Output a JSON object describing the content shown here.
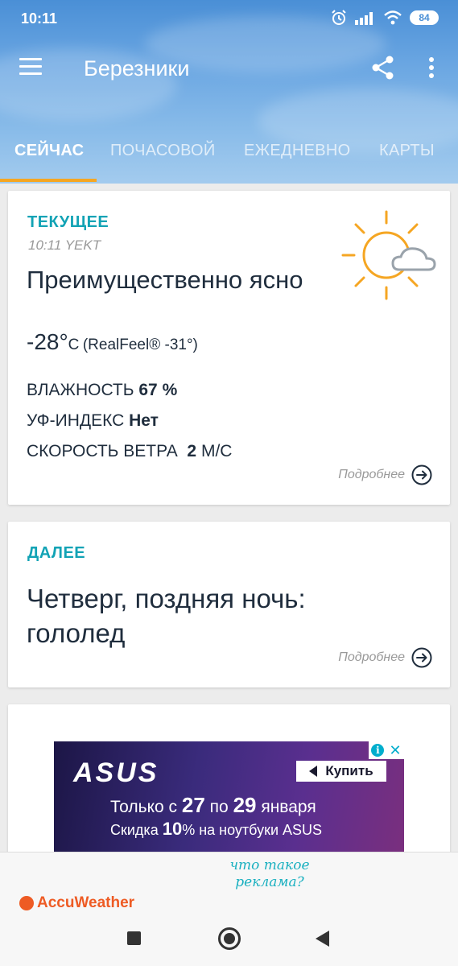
{
  "status_bar": {
    "time": "10:11",
    "battery": "84",
    "icons": [
      "alarm-icon",
      "signal-icon",
      "wifi-icon",
      "battery-icon"
    ]
  },
  "toolbar": {
    "city": "Березники",
    "icons": [
      "menu-icon",
      "share-icon",
      "more-vert-icon"
    ]
  },
  "tabs": [
    {
      "label": "СЕЙЧАС",
      "active": true
    },
    {
      "label": "ПОЧАСОВОЙ",
      "active": false
    },
    {
      "label": "ЕЖЕДНЕВНО",
      "active": false
    },
    {
      "label": "КАРТЫ",
      "active": false
    }
  ],
  "current": {
    "label": "ТЕКУЩЕЕ",
    "time": "10:11 YEKT",
    "condition": "Преимущественно ясно",
    "temperature": "-28°",
    "unit": "C",
    "realfeel": "(RealFeel® -31°)",
    "humidity_label": "ВЛАЖНОСТЬ",
    "humidity_value": "67 %",
    "uv_label": "УФ-ИНДЕКС",
    "uv_value": "Нет",
    "wind_label": "СКОРОСТЬ ВЕТРА",
    "wind_value": "2",
    "wind_unit": "М/С",
    "more": "Подробнее",
    "icon": "mostly-sunny-icon"
  },
  "next": {
    "label": "ДАЛЕЕ",
    "text": "Четверг, поздняя ночь: гололед",
    "more": "Подробнее"
  },
  "ad": {
    "brand": "ASUS",
    "buy": "Купить",
    "line1_a": "Только с",
    "line1_b": "27",
    "line1_c": "по",
    "line1_d": "29",
    "line1_e": "января",
    "line2_a": "Скидка",
    "line2_b": "10",
    "line2_c": "% на ноутбуки ASUS",
    "what_is_ad": "что такое реклама?"
  },
  "footer": {
    "accuweather": "AccuWeather"
  },
  "colors": {
    "accent": "#12a3b5",
    "tab_indicator": "#f5a623",
    "sun": "#f5a623",
    "text": "#1f2d3d"
  }
}
